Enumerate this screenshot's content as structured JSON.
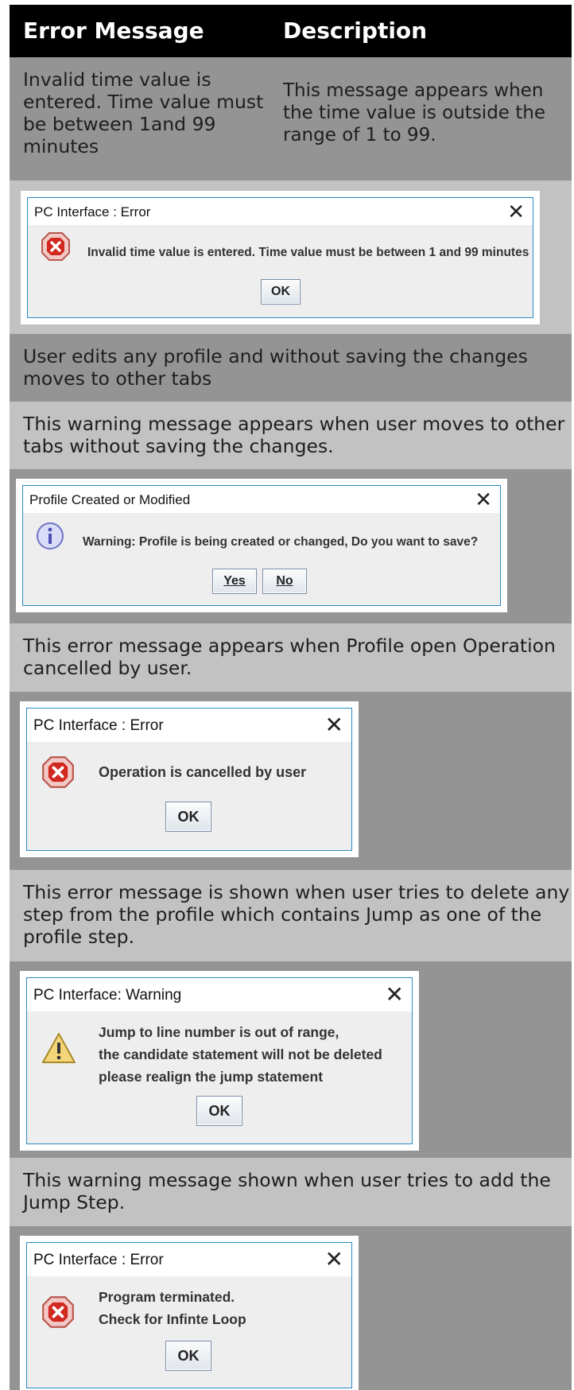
{
  "header": {
    "col1": "Error Message",
    "col2": "Description"
  },
  "row1": {
    "message_lines": [
      "Invalid time value is",
      "entered. Time value must",
      "be between 1and 99",
      "minutes"
    ],
    "description_lines": [
      "This message appears when",
      "the time value is outside the",
      "range of 1 to 99."
    ]
  },
  "dialog1": {
    "title": "PC Interface : Error",
    "close": "✕",
    "icon": "error-icon",
    "message": "Invalid time value is entered. Time value must be between 1 and 99 minutes",
    "ok": "OK"
  },
  "row2": {
    "lines": [
      "User edits any profile and without saving the changes",
      "moves to other tabs"
    ]
  },
  "row3": {
    "lines": [
      "This warning message appears when user moves to other",
      "tabs without saving the changes."
    ]
  },
  "dialog2": {
    "title": "Profile Created or Modified",
    "close": "✕",
    "icon": "info-icon",
    "message": "Warning: Profile is being created or changed, Do you want to save?",
    "yes": "Yes",
    "no": "No"
  },
  "row4": {
    "lines": [
      "This error message appears when Profile open Operation",
      "cancelled by user."
    ]
  },
  "dialog3": {
    "title": "PC Interface : Error",
    "close": "✕",
    "icon": "error-icon",
    "message": "Operation is cancelled by user",
    "ok": "OK"
  },
  "row5": {
    "lines": [
      "This error message is shown when user tries to delete any",
      "step from the profile which contains Jump as one of the",
      "profile step."
    ]
  },
  "dialog4": {
    "title": "PC Interface: Warning",
    "close": "✕",
    "icon": "warning-icon",
    "message_lines": [
      "Jump to line number is out of range,",
      "the candidate statement will not be deleted",
      "please realign the jump statement"
    ],
    "ok": "OK"
  },
  "row6": {
    "lines": [
      "This warning message shown when user tries to add the",
      "Jump Step."
    ]
  },
  "dialog5": {
    "title": "PC Interface : Error",
    "close": "✕",
    "icon": "error-icon",
    "message_lines": [
      "Program terminated.",
      "Check for Infinte Loop"
    ],
    "ok": "OK"
  },
  "colors": {
    "header_bg": "#000000",
    "dark_band": "#949494",
    "light_band": "#c2c2c2",
    "dialog_border": "#2a8bc8"
  }
}
